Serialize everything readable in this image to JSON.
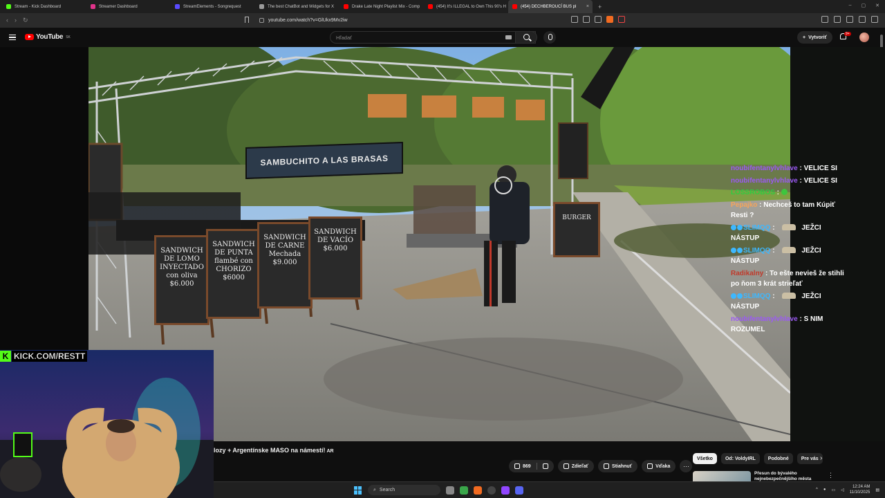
{
  "browser": {
    "tabs": [
      {
        "label": "Stream - Kick Dashboard",
        "color": "#53fc18"
      },
      {
        "label": "Streamer Dashboard",
        "color": "#e0338a"
      },
      {
        "label": "StreamElements - Songrequest",
        "color": "#5a4bff"
      },
      {
        "label": "The best ChatBot and Widgets for X",
        "color": "#9a9a9a"
      },
      {
        "label": "Drake Late Night Playlist Mix - Comp",
        "color": "#ff0000"
      },
      {
        "label": "(454) It's ILLEGAL to Own This 90's H",
        "color": "#ff0000"
      },
      {
        "label": "(454) DECHBEROUCÍ BUS pl",
        "color": "#ff0000"
      }
    ],
    "active_tab": 6,
    "new_tab": "+",
    "url": "youtube.com/watch?v=GlUkx9Mv2iw",
    "ext_badge": "1"
  },
  "youtube": {
    "logo_text": "YouTube",
    "region": "SK",
    "search_placeholder": "Hľadať",
    "create_label": "Vytvoriť",
    "notif_badge": "9+"
  },
  "video": {
    "headsign": "SAMBUCHITO A LAS BRASAS",
    "signs": [
      "SANDWICH DE LOMO INYECTADO con oliva $6.000",
      "SANDWICH DE PUNTA flambé con CHORIZO $6000",
      "SANDWICH DE CARNE Mechada $9.000",
      "SANDWICH DE VACÍO $6.000",
      "BURGER"
    ]
  },
  "chat": [
    {
      "user": "noubifentanylvhlave",
      "text": "VELICE SI",
      "color": "u"
    },
    {
      "user": "noubifentanylvhlave",
      "text": "VELICE SI",
      "color": "u"
    },
    {
      "user": "LOSSROBOS",
      "text": "",
      "color": "u g",
      "emote": "gem"
    },
    {
      "user": "Pepajko",
      "text": "Nechceš to tam Kúpiť Resti ?",
      "color": "u o"
    },
    {
      "user": "SLIMQQ",
      "text": "JEŽCI NÁSTUP",
      "color": "u c",
      "emote": "face"
    },
    {
      "user": "SLIMQQ",
      "text": "JEŽCI NÁSTUP",
      "color": "u c",
      "emote": "face"
    },
    {
      "user": "Radikalny",
      "text": "To ešte nevieš že stihli po ňom 3 krát strieľať",
      "color": "u r"
    },
    {
      "user": "SLIMQQ",
      "text": "JEŽCI NÁSTUP",
      "color": "u c",
      "emote": "face"
    },
    {
      "user": "noubifentanylvhlave",
      "text": "S NIM ROZUMEL",
      "color": "u"
    }
  ],
  "kick": {
    "letter": "K",
    "url": "KICK.COM/RESTT"
  },
  "below": {
    "title": "lozy + Argentínske MASO na námestí!",
    "title_suffix": "AR",
    "like_count": "869",
    "share": "Zdieľať",
    "download": "Stiahnuť",
    "thanks": "Vďaka",
    "more": "···",
    "chips": [
      "Všetko",
      "Od: VoldyIRL",
      "Podobné",
      "Pre vás"
    ],
    "rec_title": "Přesun do bývalého nejnebezpečnějšího města"
  },
  "taskbar": {
    "search_label": "Search",
    "time": "12:24 AM",
    "date": "11/10/2025"
  }
}
